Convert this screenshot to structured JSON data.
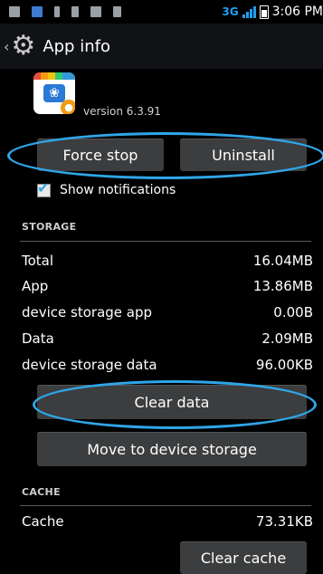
{
  "status_bar": {
    "network": "3G",
    "time": "3:06 PM",
    "icons": [
      "sms-icon",
      "sim-icon",
      "usb-icon",
      "notification-icon",
      "gallery-icon",
      "storage-icon"
    ]
  },
  "action_bar": {
    "back_chevron": "‹",
    "title": "App info"
  },
  "app": {
    "version": "version 6.3.91"
  },
  "buttons": {
    "force_stop": "Force stop",
    "uninstall": "Uninstall",
    "clear_data": "Clear data",
    "move_storage": "Move to device storage",
    "clear_cache": "Clear cache"
  },
  "notifications": {
    "label": "Show notifications",
    "checked": true
  },
  "storage": {
    "header": "STORAGE",
    "rows": [
      {
        "label": "Total",
        "value": "16.04MB"
      },
      {
        "label": "App",
        "value": "13.86MB"
      },
      {
        "label": "device storage app",
        "value": "0.00B"
      },
      {
        "label": "Data",
        "value": "2.09MB"
      },
      {
        "label": "device storage data",
        "value": "96.00KB"
      }
    ]
  },
  "cache": {
    "header": "CACHE",
    "label": "Cache",
    "value": "73.31KB"
  },
  "colors": {
    "highlight": "#2fa6e8",
    "button_bg": "#3c3d3e",
    "action_bar_bg": "#101215"
  }
}
